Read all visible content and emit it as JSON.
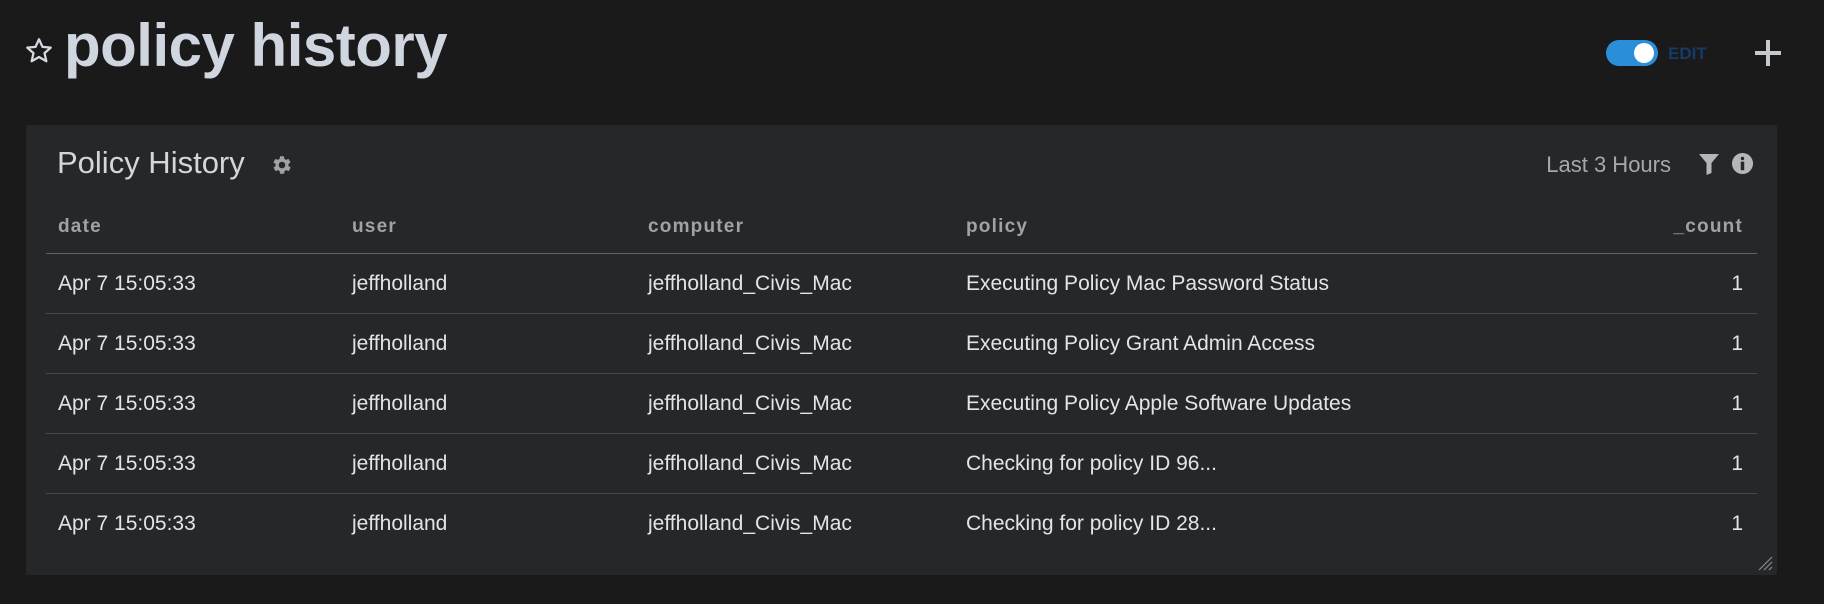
{
  "header": {
    "title": "policy history",
    "toggle_label": "EDIT",
    "toggle_on": true,
    "icons": {
      "favorite": "star-icon",
      "add": "plus-icon"
    }
  },
  "panel": {
    "title": "Policy History",
    "timerange": "Last 3 Hours",
    "icons": {
      "settings": "gear-icon",
      "filter": "filter-icon",
      "info": "info-icon",
      "resize": "resize-handle-icon"
    },
    "columns": [
      "date",
      "user",
      "computer",
      "policy",
      "_count"
    ],
    "rows": [
      [
        "Apr 7 15:05:33",
        "jeffholland",
        "jeffholland_Civis_Mac",
        "Executing Policy Mac Password Status",
        "1"
      ],
      [
        "Apr 7 15:05:33",
        "jeffholland",
        "jeffholland_Civis_Mac",
        "Executing Policy Grant Admin Access",
        "1"
      ],
      [
        "Apr 7 15:05:33",
        "jeffholland",
        "jeffholland_Civis_Mac",
        "Executing Policy Apple Software Updates",
        "1"
      ],
      [
        "Apr 7 15:05:33",
        "jeffholland",
        "jeffholland_Civis_Mac",
        "Checking for policy ID 96...",
        "1"
      ],
      [
        "Apr 7 15:05:33",
        "jeffholland",
        "jeffholland_Civis_Mac",
        "Checking for policy ID 28...",
        "1"
      ]
    ]
  },
  "colors": {
    "background": "#1a1a1b",
    "panel": "#262728",
    "accent": "#2a8fd8",
    "title": "#cfd6e0"
  }
}
